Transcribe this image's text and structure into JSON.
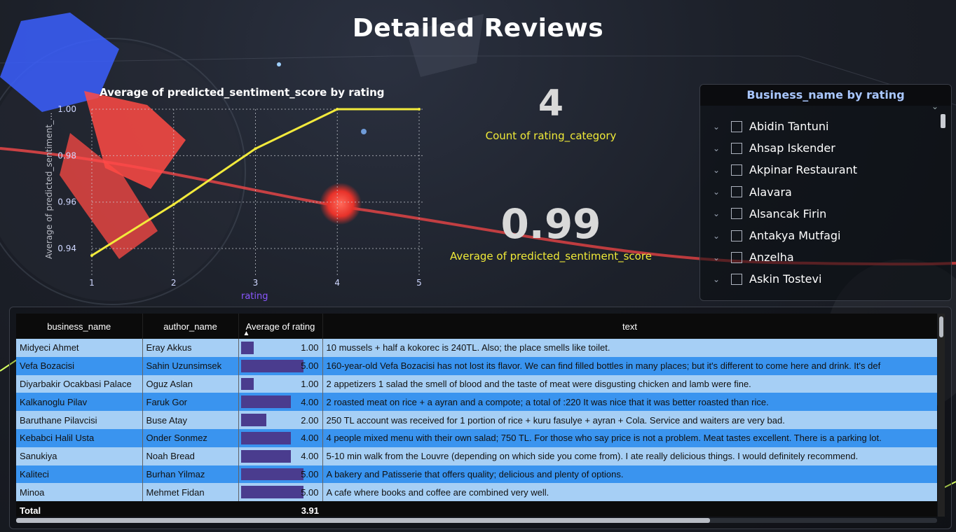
{
  "page": {
    "title": "Detailed Reviews"
  },
  "chart_data": {
    "type": "line",
    "title": "Average of predicted_sentiment_score by rating",
    "xlabel": "rating",
    "ylabel": "Average of predicted_sentiment_...",
    "x": [
      1,
      2,
      3,
      4,
      5
    ],
    "series": [
      {
        "values": [
          0.937,
          0.959,
          0.983,
          1.0,
          1.0
        ]
      }
    ],
    "x_ticks": [
      "1",
      "2",
      "3",
      "4",
      "5"
    ],
    "y_ticks": [
      "0.94",
      "0.96",
      "0.98",
      "1.00"
    ],
    "ylim": [
      0.937,
      1.0
    ],
    "grid": true,
    "line_color": "#f2ea3c"
  },
  "kpis": {
    "count": {
      "value": "4",
      "label": "Count of rating_category"
    },
    "avg": {
      "value": "0.99",
      "label": "Average of predicted_sentiment_score"
    }
  },
  "slicer": {
    "title": "Business_name by rating",
    "items": [
      "Abidin Tantuni",
      "Ahsap Iskender",
      "Akpinar Restaurant",
      "Alavara",
      "Alsancak Firin",
      "Antakya Mutfagi",
      "Anzelha",
      "Askin Tostevi"
    ]
  },
  "table": {
    "columns": [
      "business_name",
      "author_name",
      "Average of rating",
      "text"
    ],
    "rows": [
      {
        "business": "Midyeci Ahmet",
        "author": "Eray Akkus",
        "rating": "1.00",
        "rating_value": 1,
        "text": "10 mussels + half a kokorec is 240TL. Also; the place smells like toilet."
      },
      {
        "business": "Vefa Bozacisi",
        "author": "Sahin Uzunsimsek",
        "rating": "5.00",
        "rating_value": 5,
        "text": "160-year-old Vefa Bozacisi has not lost its flavor. We can find filled bottles in many places; but it's different to come here and drink. It's def"
      },
      {
        "business": "Diyarbakir Ocakbasi Palace",
        "author": "Oguz Aslan",
        "rating": "1.00",
        "rating_value": 1,
        "text": "2 appetizers 1 salad the smell of blood and the taste of meat were disgusting chicken and lamb were fine."
      },
      {
        "business": "Kalkanoglu Pilav",
        "author": "Faruk Gor",
        "rating": "4.00",
        "rating_value": 4,
        "text": "2 roasted meat on rice + a ayran and a compote; a total of :220 It was nice that it was better roasted than rice."
      },
      {
        "business": "Baruthane Pilavcisi",
        "author": "Buse Atay",
        "rating": "2.00",
        "rating_value": 2,
        "text": "250 TL account was received for 1 portion of rice + kuru fasulye + ayran + Cola. Service and waiters are very bad."
      },
      {
        "business": "Kebabci Halil Usta",
        "author": "Onder Sonmez",
        "rating": "4.00",
        "rating_value": 4,
        "text": "4 people mixed menu with their own salad; 750 TL. For those who say price is not a problem. Meat tastes excellent. There is a parking lot."
      },
      {
        "business": "Sanukiya",
        "author": "Noah Bread",
        "rating": "4.00",
        "rating_value": 4,
        "text": "5-10 min walk from the Louvre (depending on which side you come from). I ate really delicious things. I would definitely recommend."
      },
      {
        "business": "Kaliteci",
        "author": "Burhan Yilmaz",
        "rating": "5.00",
        "rating_value": 5,
        "text": "A bakery and Patisserie that offers quality; delicious and plenty of options."
      },
      {
        "business": "Minoa",
        "author": "Mehmet Fidan",
        "rating": "5.00",
        "rating_value": 5,
        "text": "A cafe where books and coffee are combined very well."
      }
    ],
    "total_label": "Total",
    "total_value": "3.91",
    "max_rating": 5
  }
}
